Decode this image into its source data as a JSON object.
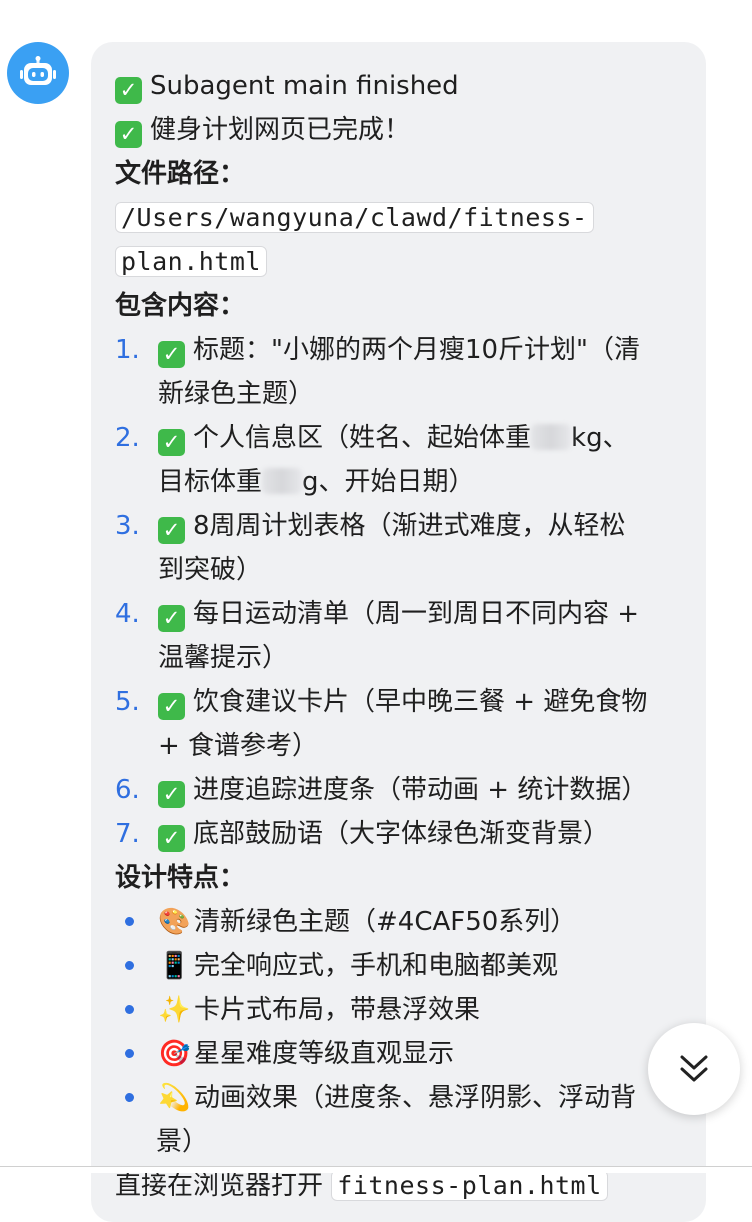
{
  "avatar": {
    "icon": "robot-icon",
    "color": "#3aa0f3"
  },
  "message": {
    "status_line_1": "Subagent main finished",
    "status_line_2": "健身计划网页已完成！",
    "file_path_heading": "文件路径：",
    "file_path_part1": "/Users/wangyuna/clawd/fitness-",
    "file_path_part2": "plan.html",
    "contents_heading": "包含内容：",
    "contents_items": [
      {
        "num": "1.",
        "line1": "标题：\"小娜的两个月瘦10斤计划\"（清",
        "line2": "新绿色主题）"
      },
      {
        "num": "2.",
        "line1a": "个人信息区（姓名、起始体重",
        "line1b": "kg、",
        "line2a": "目标体重",
        "line2b": "g、开始日期）"
      },
      {
        "num": "3.",
        "line1": "8周周计划表格（渐进式难度，从轻松",
        "line2": "到突破）"
      },
      {
        "num": "4.",
        "line1": "每日运动清单（周一到周日不同内容 +",
        "line2": "温馨提示）"
      },
      {
        "num": "5.",
        "line1": "饮食建议卡片（早中晚三餐 + 避免食物",
        "line2": "+ 食谱参考）"
      },
      {
        "num": "6.",
        "line1": "进度追踪进度条（带动画 + 统计数据）"
      },
      {
        "num": "7.",
        "line1": "底部鼓励语（大字体绿色渐变背景）"
      }
    ],
    "design_heading": "设计特点：",
    "design_items": [
      {
        "emoji": "🎨",
        "icon": "palette-icon",
        "text": "清新绿色主题（#4CAF50系列）"
      },
      {
        "emoji": "📱",
        "icon": "phone-icon",
        "text": "完全响应式，手机和电脑都美观"
      },
      {
        "emoji": "✨",
        "icon": "sparkles-icon",
        "text": "卡片式布局，带悬浮效果"
      },
      {
        "emoji": "🎯",
        "icon": "target-icon",
        "text": "星星难度等级直观显示"
      },
      {
        "emoji": "💫",
        "icon": "dizzy-star-icon",
        "line1": "动画效果（进度条、悬浮阴影、浮动背",
        "line2": "景）"
      }
    ],
    "footer_text": "直接在浏览器打开",
    "footer_code": "fitness-plan.html"
  },
  "scroll_button": {
    "icon": "double-chevron-down-icon"
  },
  "colors": {
    "bubble_bg": "#f0f1f3",
    "accent_blue": "#2f6fe0",
    "check_green": "#3fb94a"
  }
}
